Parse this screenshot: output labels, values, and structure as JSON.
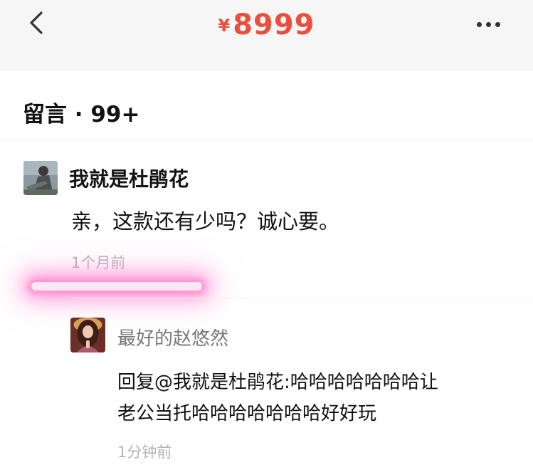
{
  "topbar": {
    "currency": "¥",
    "price": "8999",
    "back_icon": "chevron-left-icon",
    "more_icon": "more-icon"
  },
  "comments_header": {
    "title": "留言 · 99+"
  },
  "comments": [
    {
      "author": "我就是杜鹃花",
      "text": "亲，这款还有少吗？诚心要。",
      "time": "1个月前"
    }
  ],
  "reply": {
    "author": "最好的赵悠然",
    "text_line1": "回复@我就是杜鹃花:哈哈哈哈哈哈哈让",
    "text_line2": "老公当托哈哈哈哈哈哈哈好好玩",
    "time": "1分钟前"
  },
  "colors": {
    "price": "#ea4e3c",
    "highlight_glow": "#ff69c8"
  }
}
